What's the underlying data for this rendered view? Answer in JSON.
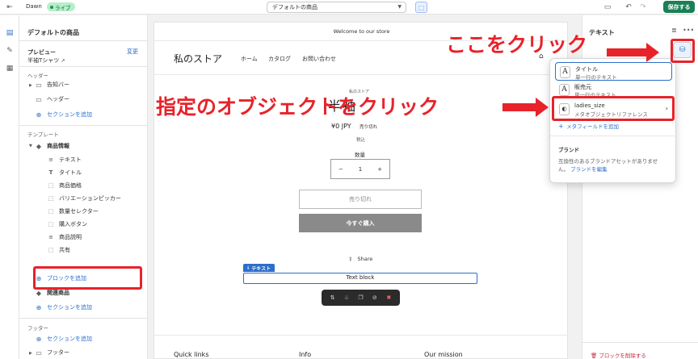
{
  "topbar": {
    "theme_name": "Dawn",
    "live_label": "ライブ",
    "template_select": "デフォルトの商品",
    "save_label": "保存する"
  },
  "left_panel": {
    "title": "デフォルトの商品",
    "preview_label": "プレビュー",
    "preview_change": "変更",
    "preview_product": "半袖Tシャツ",
    "header_section_label": "ヘッダー",
    "header_items": [
      "告知バー",
      "ヘッダー"
    ],
    "add_section": "セクションを追加",
    "template_label": "テンプレート",
    "product_info": "商品情報",
    "product_blocks": [
      "テキスト",
      "タイトル",
      "商品価格",
      "バリエーションピッカー",
      "数量セレクター",
      "購入ボタン",
      "商品説明",
      "共有"
    ],
    "add_block": "ブロックを追加",
    "related_products": "関連商品",
    "footer_label": "フッター",
    "footer_item": "フッター"
  },
  "store": {
    "announcement": "Welcome to our store",
    "logo": "私のストア",
    "nav": [
      "ホーム",
      "カタログ",
      "お問い合わせ"
    ],
    "vendor": "私のストア",
    "product_title": "半袖",
    "price": "¥0 JPY",
    "sold_out_badge": "売り切れ",
    "tax_note": "税込",
    "qty_label": "数量",
    "qty_value": "1",
    "sold_out_button": "売り切れ",
    "buy_now": "今すぐ購入",
    "share": "Share",
    "block_tag": "テキスト",
    "text_block": "Text block",
    "footer_headings": [
      "Quick links",
      "Info",
      "Our mission"
    ]
  },
  "right_panel": {
    "title": "テキスト",
    "delete_block": "ブロックを削除する"
  },
  "popover": {
    "items": [
      {
        "icon": "A",
        "name": "タイトル",
        "sub": "単一行のテキスト"
      },
      {
        "icon": "A",
        "name": "販売元",
        "sub": "単一行のテキスト"
      },
      {
        "icon": "◐",
        "name": "ladies_size",
        "sub": "メタオブジェクトリファレンス"
      }
    ],
    "add_metafield": "メタフィールドを追加",
    "brand_heading": "ブランド",
    "brand_text": "互換性のあるブランドアセットがありませ\nん。",
    "brand_link": "ブランドを編集"
  },
  "annotations": {
    "top_text": "ここをクリック",
    "mid_text": "指定のオブジェクトをクリック",
    "color": "#e8222a"
  },
  "colors": {
    "accent": "#2c6ecb",
    "save_green": "#1a7f55",
    "live_badge": "#b3f0c9",
    "danger": "#c5283d"
  }
}
